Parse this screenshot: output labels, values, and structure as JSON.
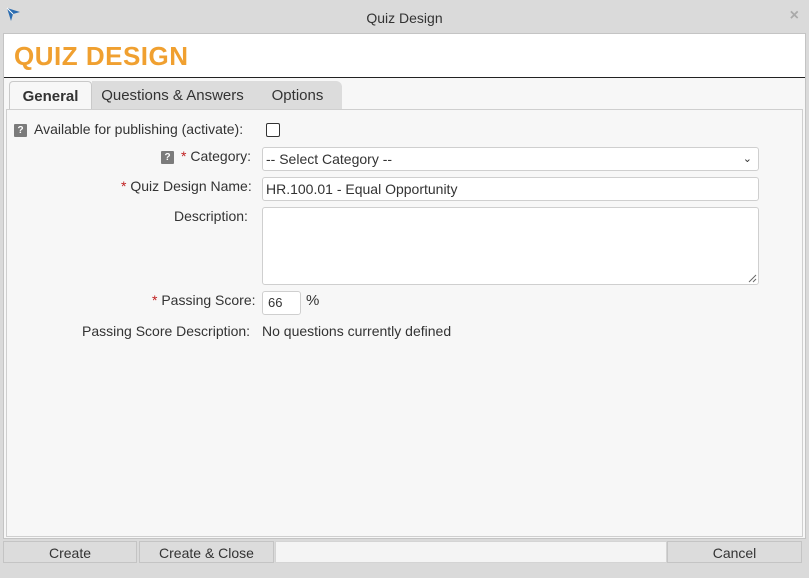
{
  "window": {
    "title": "Quiz Design",
    "close_glyph": "×"
  },
  "header": {
    "title": "QUIZ DESIGN"
  },
  "tabs": [
    {
      "label": "General"
    },
    {
      "label": "Questions & Answers"
    },
    {
      "label": "Options"
    }
  ],
  "form": {
    "help_glyph": "?",
    "required_mark": "*",
    "available": {
      "label": "Available for publishing (activate):",
      "checked": false
    },
    "category": {
      "label": "Category:",
      "value": "-- Select Category --",
      "chevron": "⌄"
    },
    "quiz_name": {
      "label": "Quiz Design Name:",
      "value": "HR.100.01 - Equal Opportunity"
    },
    "description": {
      "label": "Description:",
      "value": ""
    },
    "passing_score": {
      "label": "Passing Score:",
      "value": "66",
      "unit": "%"
    },
    "passing_score_desc": {
      "label": "Passing Score Description:",
      "value": "No questions currently defined"
    }
  },
  "footer": {
    "create_label": "Create",
    "create_close_label": "Create & Close",
    "cancel_label": "Cancel"
  },
  "colors": {
    "accent": "#f0a030",
    "required": "#c02020"
  }
}
